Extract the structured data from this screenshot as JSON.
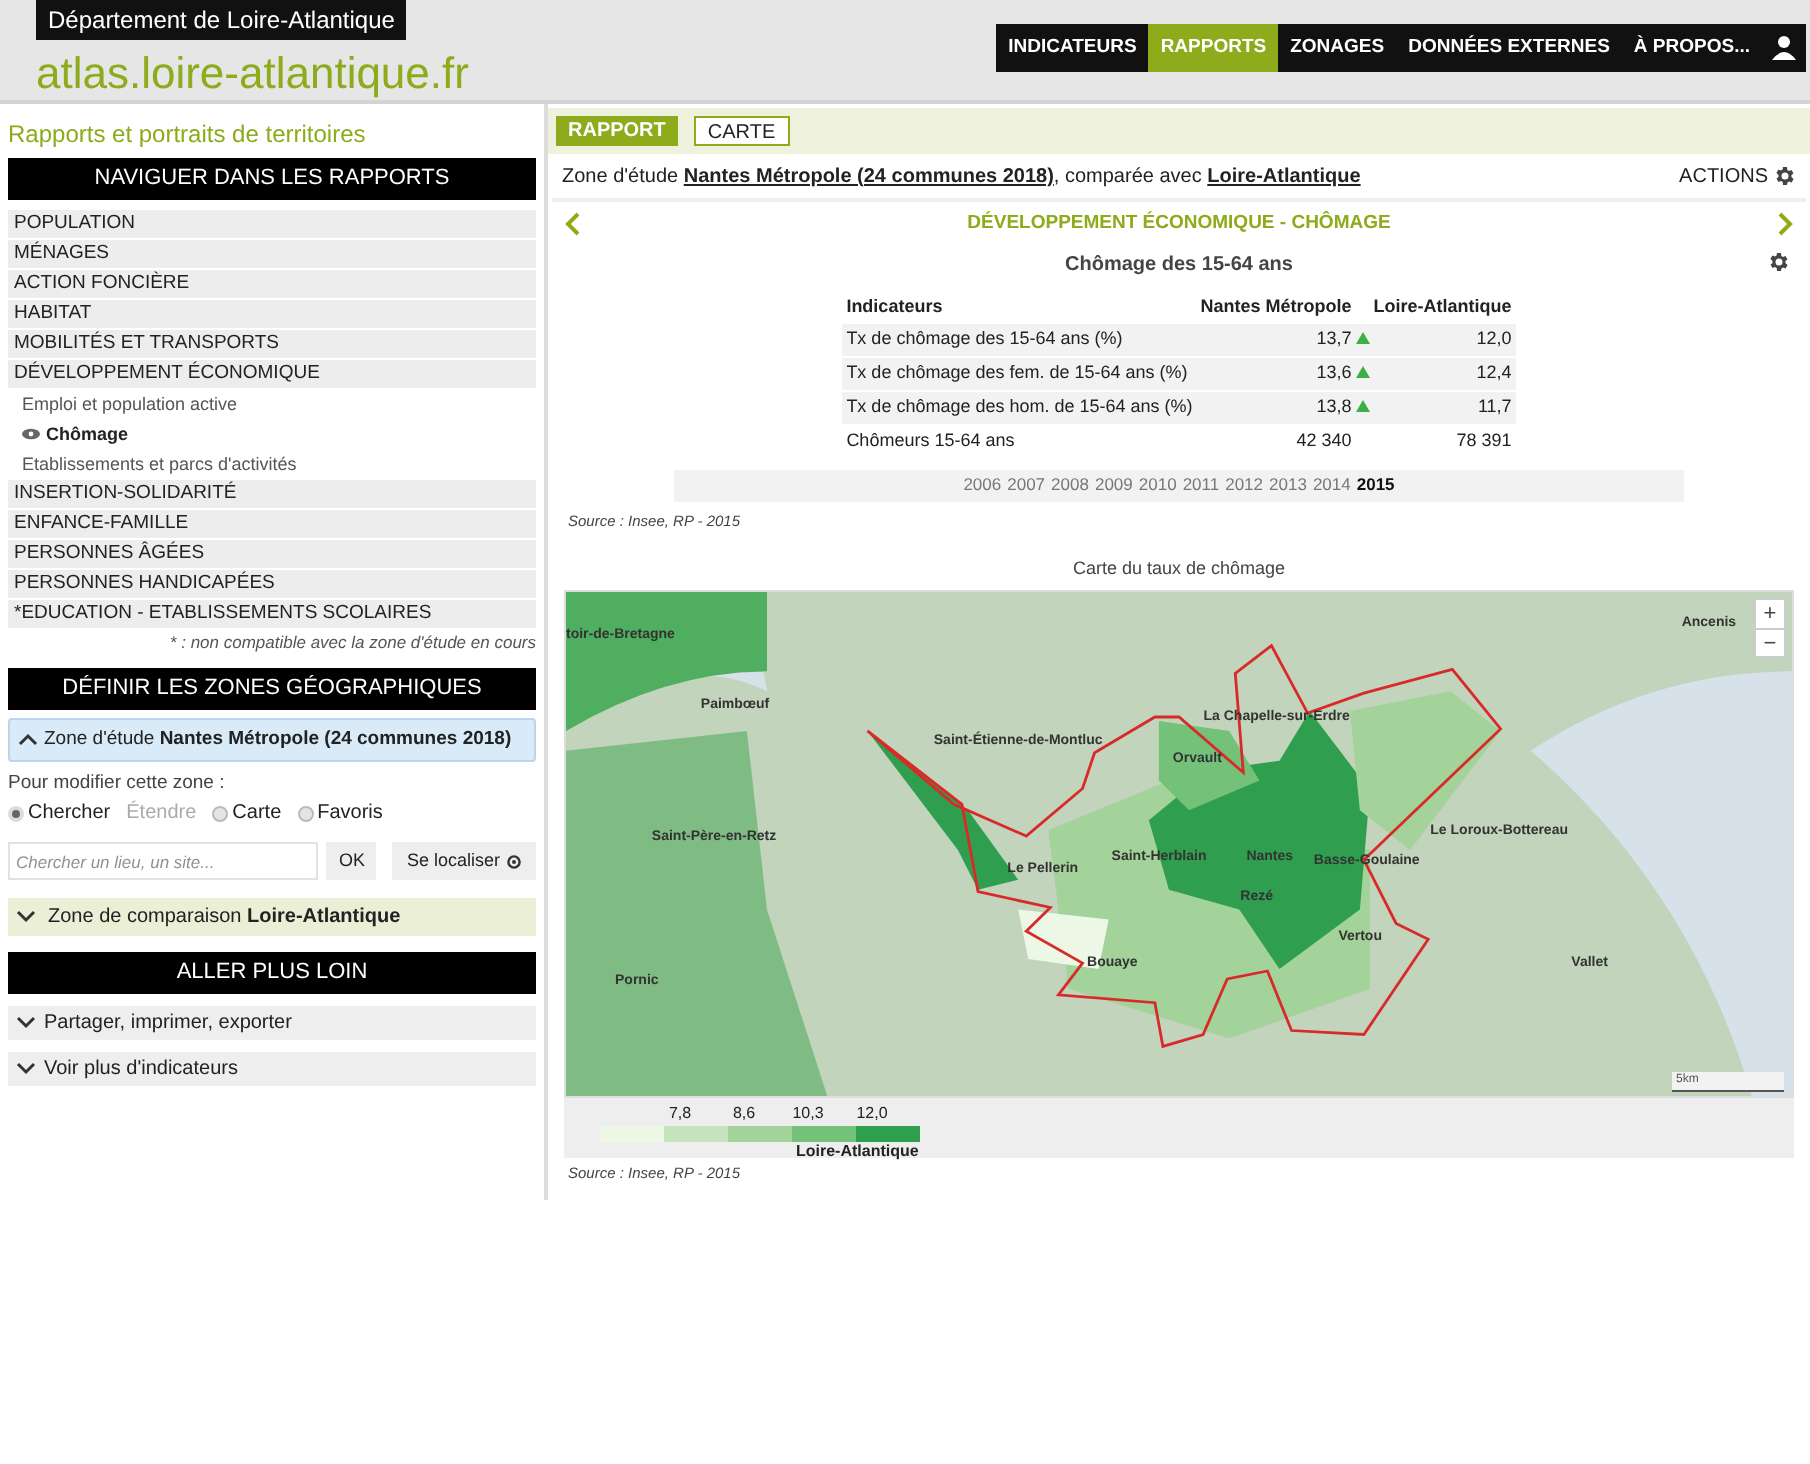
{
  "header": {
    "department": "Département de Loire-Atlantique",
    "logo": {
      "brand": "atlas",
      "domain": ".loire-atlantique",
      "tld": ".fr"
    },
    "nav": [
      {
        "label": "INDICATEURS",
        "selected": false
      },
      {
        "label": "RAPPORTS",
        "selected": true
      },
      {
        "label": "ZONAGES",
        "selected": false
      },
      {
        "label": "DONNÉES EXTERNES",
        "selected": false
      },
      {
        "label": "À PROPOS...",
        "selected": false
      }
    ]
  },
  "sidebar": {
    "title": "Rapports et portraits de territoires",
    "nav_heading": "NAVIGUER DANS LES RAPPORTS",
    "report_items": [
      {
        "label": "POPULATION",
        "kind": "category",
        "selected": false
      },
      {
        "label": "MÉNAGES",
        "kind": "category",
        "selected": false
      },
      {
        "label": "ACTION FONCIÈRE",
        "kind": "category",
        "selected": false
      },
      {
        "label": "HABITAT",
        "kind": "category",
        "selected": false
      },
      {
        "label": "MOBILITÉS ET TRANSPORTS",
        "kind": "category",
        "selected": false
      },
      {
        "label": "DÉVELOPPEMENT ÉCONOMIQUE",
        "kind": "category",
        "selected": false
      },
      {
        "label": "Emploi et population active",
        "kind": "subitem",
        "selected": false
      },
      {
        "label": "Chômage",
        "kind": "subitem",
        "selected": true
      },
      {
        "label": "Etablissements et parcs d'activités",
        "kind": "subitem",
        "selected": false
      },
      {
        "label": "INSERTION-SOLIDARITÉ",
        "kind": "category",
        "selected": false
      },
      {
        "label": "ENFANCE-FAMILLE",
        "kind": "category",
        "selected": false
      },
      {
        "label": "PERSONNES ÂGÉES",
        "kind": "category",
        "selected": false
      },
      {
        "label": "PERSONNES HANDICAPÉES",
        "kind": "category",
        "selected": false
      },
      {
        "label": "*EDUCATION - ETABLISSEMENTS SCOLAIRES",
        "kind": "category",
        "selected": false
      }
    ],
    "note": "* : non compatible avec la zone d'étude en cours",
    "zones_heading": "DÉFINIR LES ZONES GÉOGRAPHIQUES",
    "study_zone": {
      "prefix": "Zone d'étude",
      "name": "Nantes Métropole (24 communes 2018)",
      "expanded": true
    },
    "modify_label": "Pour modifier cette zone :",
    "radios": [
      {
        "label": "Chercher",
        "selected": true,
        "disabled": false
      },
      {
        "label": "Étendre",
        "selected": false,
        "disabled": true
      },
      {
        "label": "Carte",
        "selected": false,
        "disabled": false
      },
      {
        "label": "Favoris",
        "selected": false,
        "disabled": false
      }
    ],
    "search": {
      "placeholder": "Chercher un lieu, un site..."
    },
    "ok_button": "OK",
    "locate_button": "Se localiser",
    "comparison_zone": {
      "prefix": "Zone de comparaison",
      "name": "Loire-Atlantique",
      "expanded": false
    },
    "further_heading": "ALLER PLUS LOIN",
    "further_items": [
      {
        "label": "Partager, imprimer, exporter",
        "expanded": false
      },
      {
        "label": "Voir plus d'indicateurs",
        "expanded": false
      }
    ]
  },
  "main": {
    "view_tabs": [
      {
        "label": "RAPPORT",
        "selected": true
      },
      {
        "label": "CARTE",
        "selected": false
      }
    ],
    "zone_line": {
      "prefix": "Zone d'étude",
      "study": "Nantes Métropole (24 communes 2018)",
      "middle": ", comparée avec",
      "comparison": "Loire-Atlantique"
    },
    "actions": "ACTIONS",
    "section_title": "DÉVELOPPEMENT ÉCONOMIQUE - CHÔMAGE",
    "table": {
      "title": "Chômage des 15-64 ans",
      "columns": [
        "Indicateurs",
        "Nantes Métropole",
        "Loire-Atlantique"
      ],
      "rows": [
        {
          "label": "Tx de chômage des 15-64 ans (%)",
          "value_a": "13,7",
          "rising": true,
          "value_b": "12,0"
        },
        {
          "label": "Tx de chômage des fem. de 15-64 ans (%)",
          "value_a": "13,6",
          "rising": true,
          "value_b": "12,4"
        },
        {
          "label": "Tx de chômage des hom. de 15-64 ans (%)",
          "value_a": "13,8",
          "rising": true,
          "value_b": "11,7"
        },
        {
          "label": "Chômeurs 15-64 ans",
          "value_a": "42 340",
          "rising": false,
          "value_b": "78 391"
        }
      ]
    },
    "years": [
      {
        "label": "2006",
        "selected": false
      },
      {
        "label": "2007",
        "selected": false
      },
      {
        "label": "2008",
        "selected": false
      },
      {
        "label": "2009",
        "selected": false
      },
      {
        "label": "2010",
        "selected": false
      },
      {
        "label": "2011",
        "selected": false
      },
      {
        "label": "2012",
        "selected": false
      },
      {
        "label": "2013",
        "selected": false
      },
      {
        "label": "2014",
        "selected": false
      },
      {
        "label": "2015",
        "selected": true
      }
    ],
    "source": "Source : Insee, RP - 2015",
    "map": {
      "title": "Carte du taux de chômage",
      "places": [
        {
          "name": "toir-de-Bretagne"
        },
        {
          "name": "Paimbœuf"
        },
        {
          "name": "Saint-Étienne-de-Montluc"
        },
        {
          "name": "La Chapelle-sur-Erdre"
        },
        {
          "name": "Orvault"
        },
        {
          "name": "Saint-Herblain"
        },
        {
          "name": "Nantes"
        },
        {
          "name": "Basse-Goulaine"
        },
        {
          "name": "Le Pellerin"
        },
        {
          "name": "Rezé"
        },
        {
          "name": "Bouaye"
        },
        {
          "name": "Vertou"
        },
        {
          "name": "Saint-Père-en-Retz"
        },
        {
          "name": "Pornic"
        },
        {
          "name": "Le Loroux-Bottereau"
        },
        {
          "name": "Vallet"
        },
        {
          "name": "Ancenis"
        }
      ],
      "zoom_in": "+",
      "zoom_out": "−",
      "scale": "5km",
      "legend": {
        "thresholds": [
          "7,8",
          "8,6",
          "10,3",
          "12,0"
        ],
        "classes": [
          {
            "color": "#edf7e6"
          },
          {
            "color": "#c6e3bd"
          },
          {
            "color": "#a3d39b"
          },
          {
            "color": "#74c27a"
          },
          {
            "color": "#2f9e4f"
          }
        ],
        "reference": "Loire-Atlantique"
      }
    },
    "map_source": "Source : Insee, RP - 2015"
  }
}
